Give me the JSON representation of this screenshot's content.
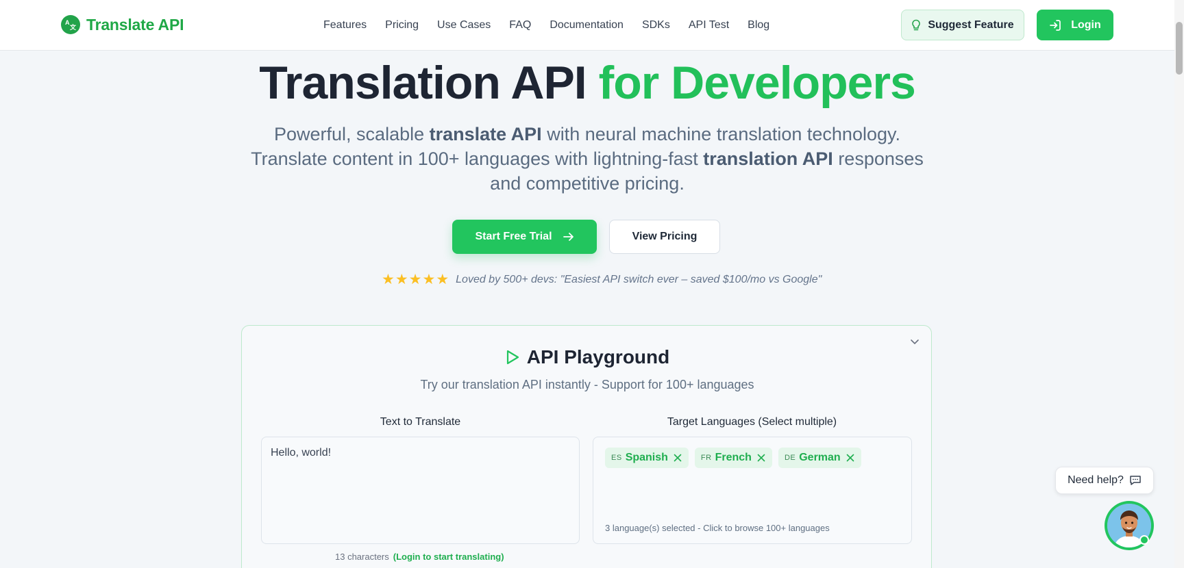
{
  "nav": {
    "logo_text": "Translate API",
    "links": [
      "Features",
      "Pricing",
      "Use Cases",
      "FAQ",
      "Documentation",
      "SDKs",
      "API Test",
      "Blog"
    ],
    "suggest_label": "Suggest Feature",
    "login_label": "Login"
  },
  "hero": {
    "title_main": "Translation API ",
    "title_accent": "for Developers",
    "sub_1": "Powerful, scalable ",
    "sub_b1": "translate API",
    "sub_2": " with neural machine translation technology. Translate content in 100+ languages with lightning-fast ",
    "sub_b2": "translation API",
    "sub_3": " responses and competitive pricing.",
    "cta_primary": "Start Free Trial",
    "cta_secondary": "View Pricing",
    "rating_stars": 5,
    "quote": "Loved by 500+ devs: \"Easiest API switch ever – saved $100/mo vs Google\""
  },
  "playground": {
    "title": "API Playground",
    "subtitle": "Try our translation API instantly - Support for 100+ languages",
    "text_label": "Text to Translate",
    "text_value": "Hello, world!",
    "target_label": "Target Languages (Select multiple)",
    "languages": [
      {
        "code": "ES",
        "name": "Spanish"
      },
      {
        "code": "FR",
        "name": "French"
      },
      {
        "code": "DE",
        "name": "German"
      }
    ],
    "lang_hint": "3 language(s) selected - Click to browse 100+ languages",
    "char_count": "13 characters",
    "login_prompt": "(Login to start translating)"
  },
  "help": {
    "label": "Need help?"
  },
  "colors": {
    "brand_green": "#22c55e",
    "title_dark": "#1e2533",
    "muted": "#5a6b80"
  }
}
